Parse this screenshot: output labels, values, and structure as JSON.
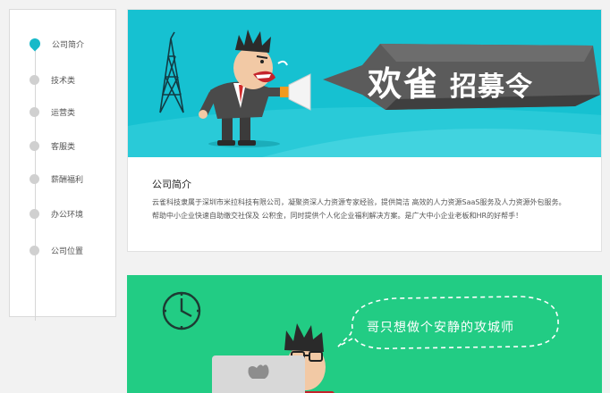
{
  "sidebar": {
    "items": [
      {
        "label": "公司简介",
        "active": true
      },
      {
        "label": "技术类",
        "active": false
      },
      {
        "label": "运营类",
        "active": false
      },
      {
        "label": "客服类",
        "active": false
      },
      {
        "label": "薪酬福利",
        "active": false
      },
      {
        "label": "办公环境",
        "active": false
      },
      {
        "label": "公司位置",
        "active": false
      }
    ]
  },
  "banner": {
    "headline_1": "欢雀",
    "headline_2": "招募令"
  },
  "intro": {
    "title": "公司简介",
    "line1": "云雀科技隶属于深圳市米拉科技有限公司，凝聚资深人力资源专家经验，提供简洁 高效的人力资源SaaS服务及人力资源外包服务。",
    "line2": "帮助中小企业快速自助缴交社保及 公积金，同时提供个人化企业福利解决方案。是广大中小企业老板和HR的好帮手！"
  },
  "banner2": {
    "bubble_text": "哥只想做个安静的攻城师"
  },
  "colors": {
    "accent": "#17b9c9",
    "banner1_bg": "#16c1d1",
    "banner2_bg": "#22cc84"
  }
}
